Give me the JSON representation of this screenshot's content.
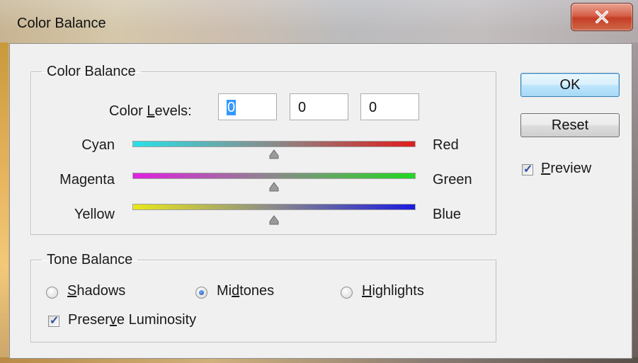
{
  "window": {
    "title": "Color Balance",
    "close_icon": "close-icon"
  },
  "color_balance": {
    "group_label": "Color Balance",
    "levels_label_pre": "Color ",
    "levels_label_u": "L",
    "levels_label_post": "evels:",
    "levels": [
      "0",
      "0",
      "0"
    ],
    "sliders": [
      {
        "left": "Cyan",
        "right": "Red",
        "value": 0,
        "min": -100,
        "max": 100,
        "from": "#29e0e8",
        "to": "#e01c1c"
      },
      {
        "left": "Magenta",
        "right": "Green",
        "value": 0,
        "min": -100,
        "max": 100,
        "from": "#e020e0",
        "to": "#22d822"
      },
      {
        "left": "Yellow",
        "right": "Blue",
        "value": 0,
        "min": -100,
        "max": 100,
        "from": "#e8e81a",
        "to": "#1a1ae0"
      }
    ]
  },
  "tone_balance": {
    "group_label": "Tone Balance",
    "options": [
      {
        "u": "S",
        "rest": "hadows",
        "pre": "",
        "selected": false
      },
      {
        "pre": "Mi",
        "u": "d",
        "rest": "tones",
        "selected": true
      },
      {
        "pre": "",
        "u": "H",
        "rest": "ighlights",
        "selected": false
      }
    ],
    "preserve_pre": "Preser",
    "preserve_u": "v",
    "preserve_post": "e Luminosity",
    "preserve_checked": true
  },
  "buttons": {
    "ok": "OK",
    "reset": "Reset"
  },
  "preview": {
    "u": "P",
    "rest": "review",
    "checked": true
  }
}
